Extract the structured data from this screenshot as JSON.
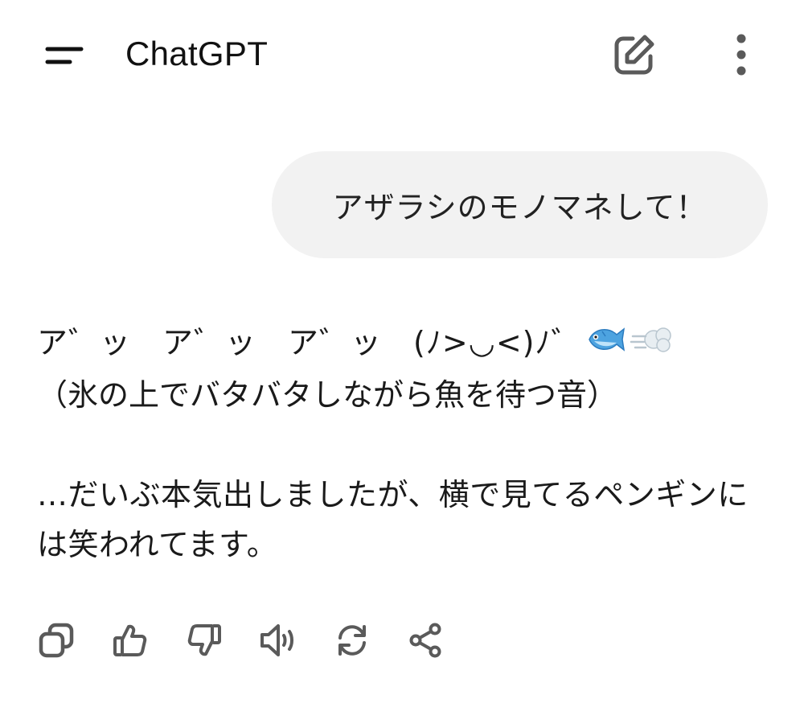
{
  "header": {
    "title": "ChatGPT",
    "menu_icon": "hamburger-menu-icon",
    "new_chat_icon": "edit-square-icon",
    "more_icon": "more-vertical-icon"
  },
  "conversation": {
    "user_message": "アザラシのモノマネして！",
    "assistant": {
      "line1_text": "ア゛ッ　ア゛ッ　ア゛ッ　(ﾉ>◡<)ﾉ゛",
      "line1_emojis": [
        "fish-emoji",
        "dash-emoji"
      ],
      "line2_text": "（氷の上でバタバタしながら魚を待つ音）",
      "paragraph2": "…だいぶ本気出しましたが、横で見てるペンギンには笑われてます。"
    }
  },
  "actions": [
    {
      "name": "copy-button",
      "icon": "copy-icon"
    },
    {
      "name": "thumbs-up-button",
      "icon": "thumbs-up-icon"
    },
    {
      "name": "thumbs-down-button",
      "icon": "thumbs-down-icon"
    },
    {
      "name": "read-aloud-button",
      "icon": "speaker-icon"
    },
    {
      "name": "regenerate-button",
      "icon": "refresh-icon"
    },
    {
      "name": "share-button",
      "icon": "share-icon"
    }
  ],
  "colors": {
    "background": "#ffffff",
    "bubble": "#f2f2f2",
    "text": "#111111",
    "icon": "#5a5a5a"
  }
}
